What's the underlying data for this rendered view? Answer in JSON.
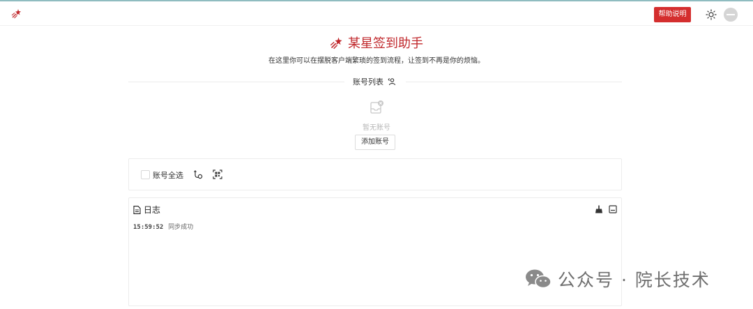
{
  "header": {
    "help_label": "帮助说明",
    "logo_icon": "shooting-star-icon",
    "theme_icon": "sun-icon",
    "avatar_icon": "avatar"
  },
  "hero": {
    "title": "某星签到助手",
    "subtitle": "在这里你可以在摆脱客户端繁琐的签到流程，让签到不再是你的烦恼。",
    "accent_color": "#c0282c"
  },
  "accounts": {
    "section_title": "账号列表",
    "empty_text": "暂无账号",
    "add_button_label": "添加账号"
  },
  "toolbar": {
    "select_all_label": "账号全选",
    "select_all_checked": false
  },
  "log": {
    "title": "日志",
    "entries": [
      {
        "time": "15:59:52",
        "message": "同步成功"
      }
    ]
  },
  "watermark": {
    "text": "公众号 · 院长技术"
  },
  "colors": {
    "help_button": "#d42e2e",
    "top_line": "#8fbcc0"
  }
}
